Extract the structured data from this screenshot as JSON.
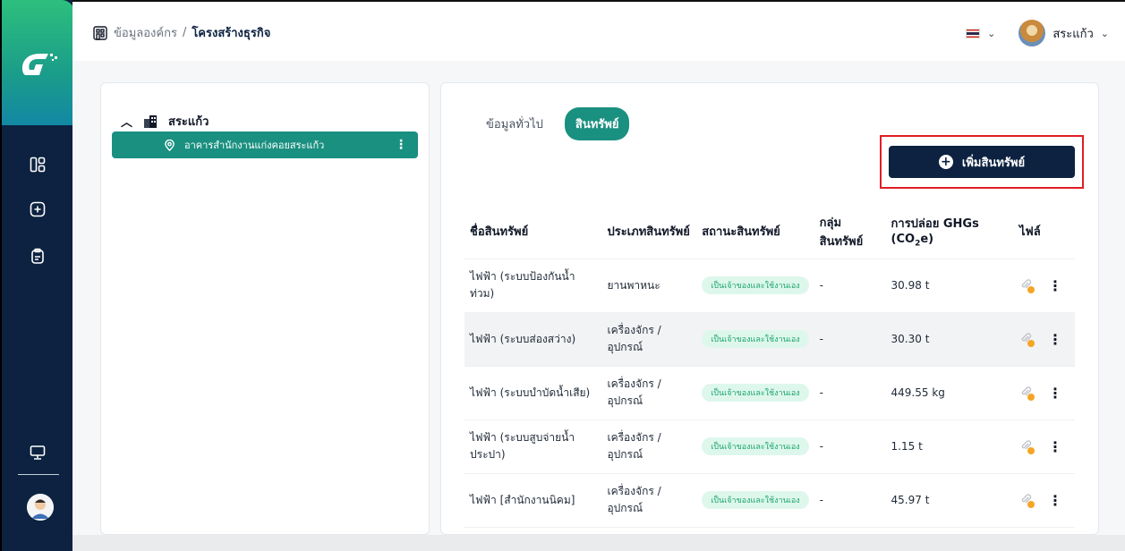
{
  "breadcrumb": {
    "parent": "ข้อมูลองค์กร",
    "separator": "/",
    "current": "โครงสร้างธุรกิจ"
  },
  "user": {
    "name": "สระแก้ว"
  },
  "tree": {
    "root_label": "สระแก้ว",
    "child_label": "อาคารสำนักงานแก่งคอยสระแก้ว"
  },
  "tabs": [
    {
      "label": "ข้อมูลทั่วไป",
      "active": false
    },
    {
      "label": "สินทรัพย์",
      "active": true
    }
  ],
  "add_button": {
    "label": "เพิ่มสินทรัพย์"
  },
  "table": {
    "headers": {
      "name": "ชื่อสินทรัพย์",
      "type": "ประเภทสินทรัพย์",
      "status": "สถานะสินทรัพย์",
      "group_line1": "กลุ่ม",
      "group_line2": "สินทรัพย์",
      "emission_line1": "การปล่อย GHGs",
      "emission_co": "(CO",
      "emission_sub": "2",
      "emission_tail": "e)",
      "file": "ไฟล์"
    },
    "rows": [
      {
        "name": "ไฟฟ้า (ระบบป้องกันน้ำท่วม)",
        "type1": "ยานพาหนะ",
        "type2": "",
        "status": "เป็นเจ้าของและใช้งานเอง",
        "group": "-",
        "emission": "30.98 t"
      },
      {
        "name": "ไฟฟ้า (ระบบส่องสว่าง)",
        "type1": "เครื่องจักร /",
        "type2": "อุปกรณ์",
        "status": "เป็นเจ้าของและใช้งานเอง",
        "group": "-",
        "emission": "30.30 t"
      },
      {
        "name": "ไฟฟ้า (ระบบบำบัดน้ำเสีย)",
        "type1": "เครื่องจักร /",
        "type2": "อุปกรณ์",
        "status": "เป็นเจ้าของและใช้งานเอง",
        "group": "-",
        "emission": "449.55 kg"
      },
      {
        "name": "ไฟฟ้า (ระบบสูบจ่ายน้ำประปา)",
        "type1": "เครื่องจักร /",
        "type2": "อุปกรณ์",
        "status": "เป็นเจ้าของและใช้งานเอง",
        "group": "-",
        "emission": "1.15 t"
      },
      {
        "name": "ไฟฟ้า [สำนักงานนิคม]",
        "type1": "เครื่องจักร /",
        "type2": "อุปกรณ์",
        "status": "เป็นเจ้าของและใช้งานเอง",
        "group": "-",
        "emission": "45.97 t"
      }
    ]
  },
  "colors": {
    "sidebar": "#0c2240",
    "accent_teal": "#1a9080",
    "button_navy": "#0c2240",
    "highlight_red": "#e11d24",
    "badge_bg": "#def7ec",
    "badge_text": "#1aa46e"
  },
  "icons": {
    "sidebar": [
      "logo-icon",
      "dashboard-icon",
      "add-square-icon",
      "clipboard-icon",
      "monitor-icon"
    ],
    "breadcrumb": "building-icon",
    "tree_root": "building-icon",
    "tree_child": "location-pin-icon",
    "file": "paperclip-icon"
  }
}
